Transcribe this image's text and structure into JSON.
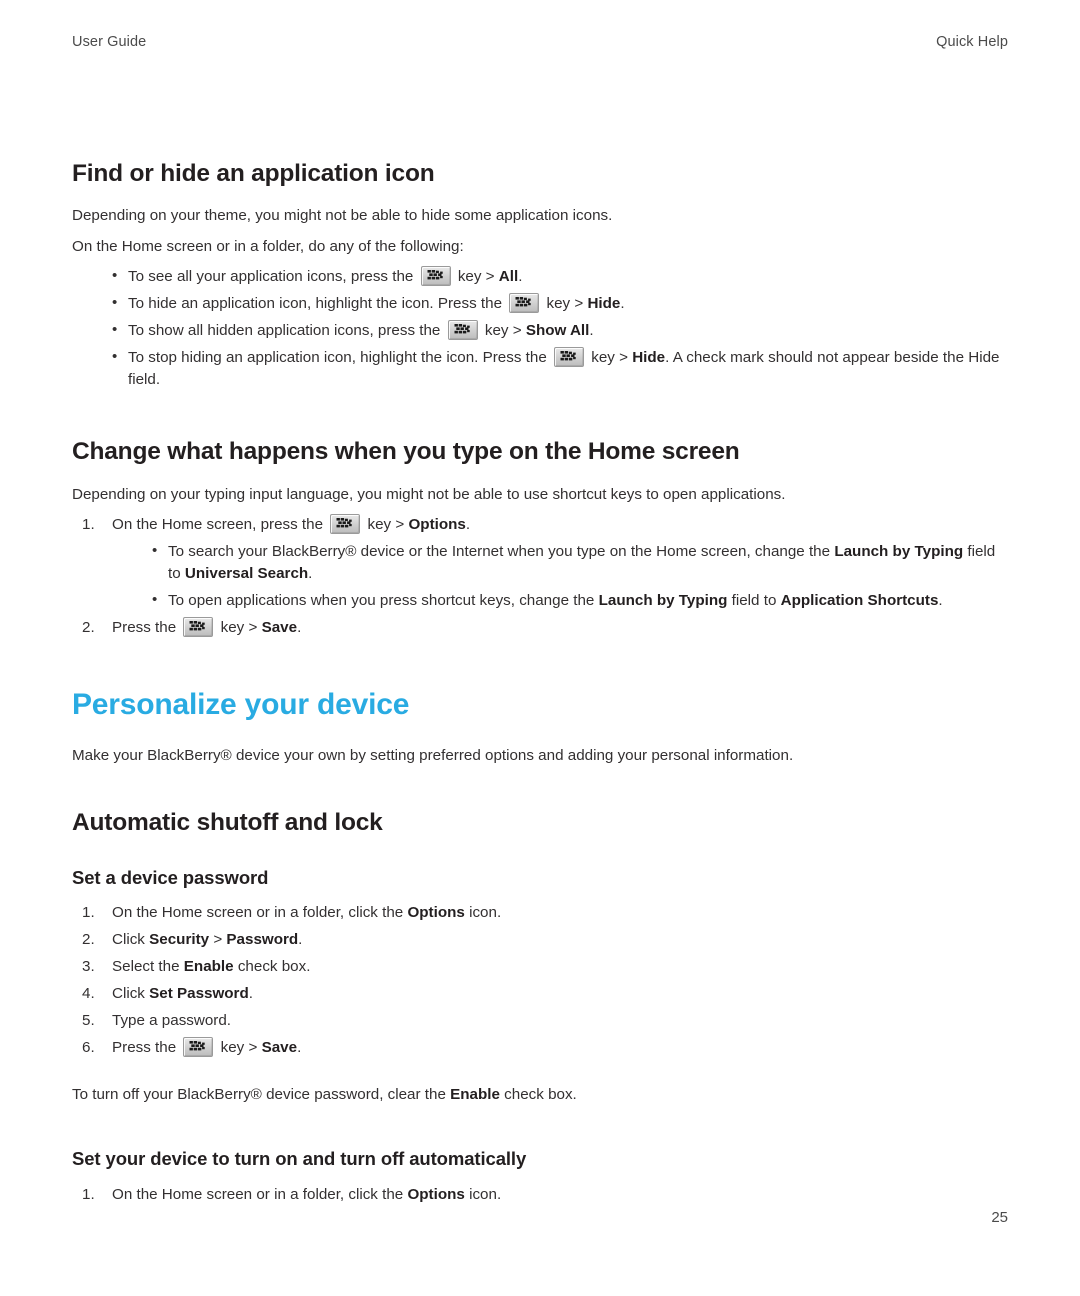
{
  "header": {
    "left": "User Guide",
    "right": "Quick Help"
  },
  "footer": {
    "page_number": "25"
  },
  "colors": {
    "chapter_heading": "#29ABE2",
    "body_text": "#333031",
    "key_icon_face": "#cfcfcf"
  },
  "icons": {
    "menu_key": "blackberry-menu-key-icon"
  },
  "sections": {
    "find_or_hide": {
      "heading": "Find or hide an application icon",
      "intro1": "Depending on your theme, you might not be able to hide some application icons.",
      "intro2": "On the Home screen or in a folder, do any of the following:",
      "bullets": {
        "b1_a": "To see all your application icons, press the",
        "b1_b": "key >",
        "b1_bold": "All",
        "b1_c": ".",
        "b2_a": "To hide an application icon, highlight the icon. Press the",
        "b2_b": "key >",
        "b2_bold": "Hide",
        "b2_c": ".",
        "b3_a": "To show all hidden application icons, press the",
        "b3_b": "key >",
        "b3_bold": "Show All",
        "b3_c": ".",
        "b4_a": "To stop hiding an application icon, highlight the icon. Press the",
        "b4_b": "key >",
        "b4_bold": "Hide",
        "b4_c": ". A check mark should not appear beside the Hide field."
      }
    },
    "change_type": {
      "heading": "Change what happens when you type on the Home screen",
      "intro": "Depending on your typing input language, you might not be able to use shortcut keys to open applications.",
      "step1": {
        "num": "1.",
        "a": "On the Home screen, press the",
        "b": "key >",
        "bold": "Options",
        "c": "."
      },
      "sub1": {
        "a": "To search your BlackBerry® device or the Internet when you type on the Home screen, change the",
        "bold1": "Launch by Typing",
        "b": "field to",
        "bold2": "Universal Search",
        "c": "."
      },
      "sub2": {
        "a": "To open applications when you press shortcut keys, change the",
        "bold1": "Launch by Typing",
        "b": "field to",
        "bold2": "Application Shortcuts",
        "c": "."
      },
      "step2": {
        "num": "2.",
        "a": "Press the",
        "b": "key >",
        "bold": "Save",
        "c": "."
      }
    },
    "personalize": {
      "heading": "Personalize your device",
      "intro": "Make your BlackBerry® device your own by setting preferred options and adding your personal information."
    },
    "automatic_shutoff": {
      "heading": "Automatic shutoff and lock"
    },
    "set_password": {
      "heading": "Set a device password",
      "steps": [
        {
          "num": "1.",
          "a": "On the Home screen or in a folder, click the",
          "bold": "Options",
          "c": "icon."
        },
        {
          "num": "2.",
          "a": "Click",
          "bold": "Security",
          "mid": ">",
          "bold2": "Password",
          "c": "."
        },
        {
          "num": "3.",
          "a": "Select the",
          "bold": "Enable",
          "c": "check box."
        },
        {
          "num": "4.",
          "a": "Click",
          "bold": "Set Password",
          "c": "."
        },
        {
          "num": "5.",
          "a": "Type a password.",
          "bold": "",
          "c": ""
        },
        {
          "num": "6.",
          "a": "Press the",
          "b": "key >",
          "bold": "Save",
          "c": "."
        }
      ],
      "outro": {
        "a": "To turn off your BlackBerry® device password, clear the",
        "bold": "Enable",
        "c": "check box."
      }
    },
    "auto_on_off": {
      "heading": "Set your device to turn on and turn off automatically",
      "step1": {
        "num": "1.",
        "a": "On the Home screen or in a folder, click the",
        "bold": "Options",
        "c": "icon."
      }
    }
  }
}
